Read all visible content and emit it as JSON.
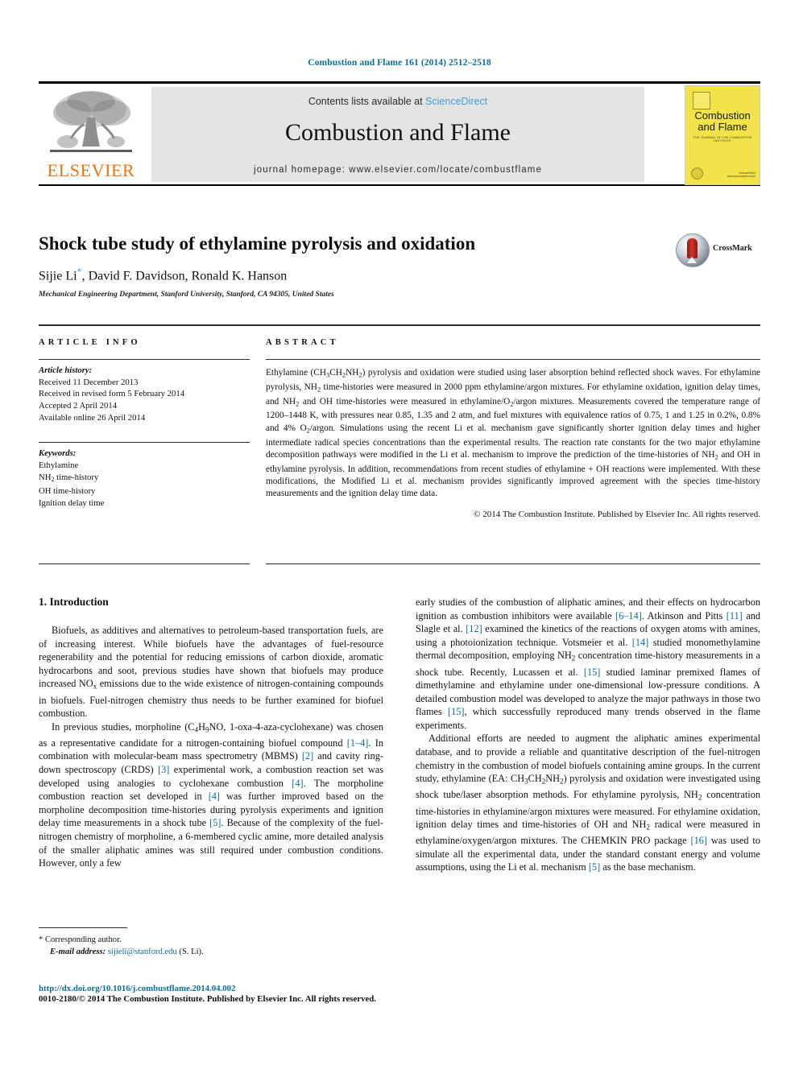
{
  "running_head": "Combustion and Flame 161 (2014) 2512–2518",
  "masthead": {
    "elsevier_wordmark": "ELSEVIER",
    "contents_prefix": "Contents lists available at ",
    "contents_link": "ScienceDirect",
    "journal_title": "Combustion and Flame",
    "homepage": "journal homepage: www.elsevier.com/locate/combustflame",
    "cover": {
      "title_line1": "Combustion",
      "title_line2": "and Flame",
      "subtitle": "THE JOURNAL OF THE COMBUSTION INSTITUTE",
      "foot": "ScienceDirect\nwww.sciencedirect.com"
    }
  },
  "title_block": {
    "title": "Shock tube study of ethylamine pyrolysis and oxidation",
    "authors": "Sijie Li",
    "authors_rest": ", David F. Davidson, Ronald K. Hanson",
    "corresponding_mark": "*",
    "affiliation": "Mechanical Engineering Department, Stanford University, Stanford, CA 94305, United States",
    "crossmark_label": "CrossMark"
  },
  "article_info": {
    "heading": "ARTICLE INFO",
    "history_label": "Article history:",
    "history": [
      "Received 11 December 2013",
      "Received in revised form 5 February 2014",
      "Accepted 2 April 2014",
      "Available online 26 April 2014"
    ],
    "keywords_label": "Keywords:",
    "keywords": [
      "Ethylamine",
      "NH2 time-history",
      "OH time-history",
      "Ignition delay time"
    ]
  },
  "abstract": {
    "heading": "ABSTRACT",
    "text": "Ethylamine (CH3CH2NH2) pyrolysis and oxidation were studied using laser absorption behind reflected shock waves. For ethylamine pyrolysis, NH2 time-histories were measured in 2000 ppm ethylamine/argon mixtures. For ethylamine oxidation, ignition delay times, and NH2 and OH time-histories were measured in ethylamine/O2/argon mixtures. Measurements covered the temperature range of 1200–1448 K, with pressures near 0.85, 1.35 and 2 atm, and fuel mixtures with equivalence ratios of 0.75, 1 and 1.25 in 0.2%, 0.8% and 4% O2/argon. Simulations using the recent Li et al. mechanism gave significantly shorter ignition delay times and higher intermediate radical species concentrations than the experimental results. The reaction rate constants for the two major ethylamine decomposition pathways were modified in the Li et al. mechanism to improve the prediction of the time-histories of NH2 and OH in ethylamine pyrolysis. In addition, recommendations from recent studies of ethylamine + OH reactions were implemented. With these modifications, the Modified Li et al. mechanism provides significantly improved agreement with the species time-history measurements and the ignition delay time data.",
    "copyright": "© 2014 The Combustion Institute. Published by Elsevier Inc. All rights reserved."
  },
  "section1": {
    "heading": "1. Introduction",
    "para1": "Biofuels, as additives and alternatives to petroleum-based transportation fuels, are of increasing interest. While biofuels have the advantages of fuel-resource regenerability and the potential for reducing emissions of carbon dioxide, aromatic hydrocarbons and soot, previous studies have shown that biofuels may produce increased NOx emissions due to the wide existence of nitrogen-containing compounds in biofuels. Fuel-nitrogen chemistry thus needs to be further examined for biofuel combustion.",
    "para2": "In previous studies, morpholine (C4H9NO, 1-oxa-4-aza-cyclohexane) was chosen as a representative candidate for a nitrogen-containing biofuel compound [1–4]. In combination with molecular-beam mass spectrometry (MBMS) [2] and cavity ring-down spectroscopy (CRDS) [3] experimental work, a combustion reaction set was developed using analogies to cyclohexane combustion [4]. The morpholine combustion reaction set developed in [4] was further improved based on the morpholine decomposition time-histories during pyrolysis experiments and ignition delay time measurements in a shock tube [5]. Because of the complexity of the fuel-nitrogen chemistry of morpholine, a 6-membered cyclic amine, more detailed analysis of the smaller aliphatic amines was still required under combustion conditions. However, only a few",
    "para3": "early studies of the combustion of aliphatic amines, and their effects on hydrocarbon ignition as combustion inhibitors were available [6–14]. Atkinson and Pitts [11] and Slagle et al. [12] examined the kinetics of the reactions of oxygen atoms with amines, using a photoionization technique. Votsmeier et al. [14] studied monomethylamine thermal decomposition, employing NH2 concentration time-history measurements in a shock tube. Recently, Lucassen et al. [15] studied laminar premixed flames of dimethylamine and ethylamine under one-dimensional low-pressure conditions. A detailed combustion model was developed to analyze the major pathways in those two flames [15], which successfully reproduced many trends observed in the flame experiments.",
    "para4": "Additional efforts are needed to augment the aliphatic amines experimental database, and to provide a reliable and quantitative description of the fuel-nitrogen chemistry in the combustion of model biofuels containing amine groups. In the current study, ethylamine (EA: CH3CH2NH2) pyrolysis and oxidation were investigated using shock tube/laser absorption methods. For ethylamine pyrolysis, NH2 concentration time-histories in ethylamine/argon mixtures were measured. For ethylamine oxidation, ignition delay times and time-histories of OH and NH2 radical were measured in ethylamine/oxygen/argon mixtures. The CHEMKIN PRO package [16] was used to simulate all the experimental data, under the standard constant energy and volume assumptions, using the Li et al. mechanism [5] as the base mechanism."
  },
  "footnote": {
    "corresponding": "* Corresponding author.",
    "email_label": "E-mail address:",
    "email": "sijieli@stanford.edu",
    "email_suffix": " (S. Li)."
  },
  "footer": {
    "doi": "http://dx.doi.org/10.1016/j.combustflame.2014.04.002",
    "issn": "0010-2180/© 2014 The Combustion Institute. Published by Elsevier Inc. All rights reserved."
  },
  "colors": {
    "link_teal": "#0b6e97",
    "link_blue": "#3d9ed6",
    "elsevier_orange": "#e87511",
    "cover_yellow": "#f2e34a",
    "band_gray": "#e4e4e4"
  }
}
